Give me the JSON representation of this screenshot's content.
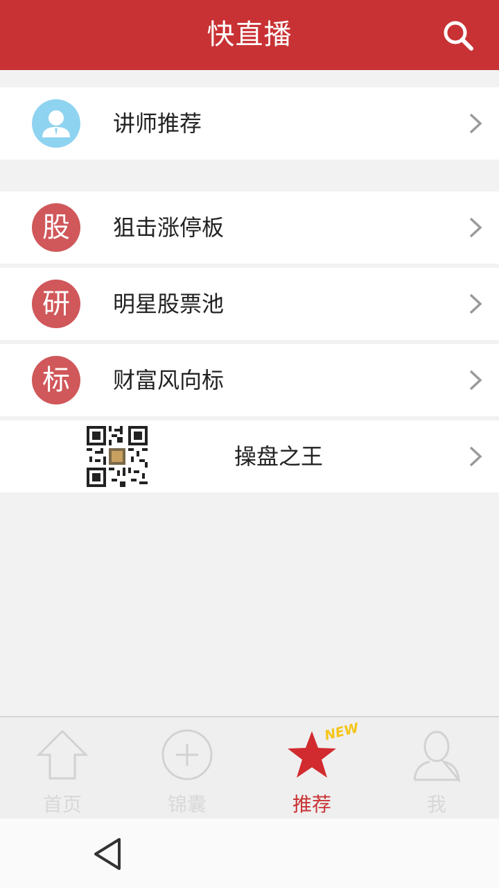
{
  "header": {
    "title": "快直播",
    "search_icon": "search-icon"
  },
  "sections": {
    "teacher": {
      "label": "讲师推荐",
      "icon": "user-avatar-icon"
    },
    "items": [
      {
        "icon_char": "股",
        "label": "狙击涨停板"
      },
      {
        "icon_char": "研",
        "label": "明星股票池"
      },
      {
        "icon_char": "标",
        "label": "财富风向标"
      }
    ],
    "qr_item": {
      "label": "操盘之王",
      "icon": "qr-code-icon"
    }
  },
  "tabbar": {
    "tabs": [
      {
        "label": "首页",
        "icon": "home-icon",
        "active": false
      },
      {
        "label": "锦囊",
        "icon": "plus-circle-icon",
        "active": false
      },
      {
        "label": "推荐",
        "icon": "star-icon",
        "badge": "NEW",
        "active": true
      },
      {
        "label": "我",
        "icon": "person-icon",
        "active": false
      }
    ]
  },
  "colors": {
    "brand": "#c93234",
    "icon_circle": "#d0575a",
    "avatar_bg": "#8ed3f0",
    "badge": "#f5c518"
  }
}
